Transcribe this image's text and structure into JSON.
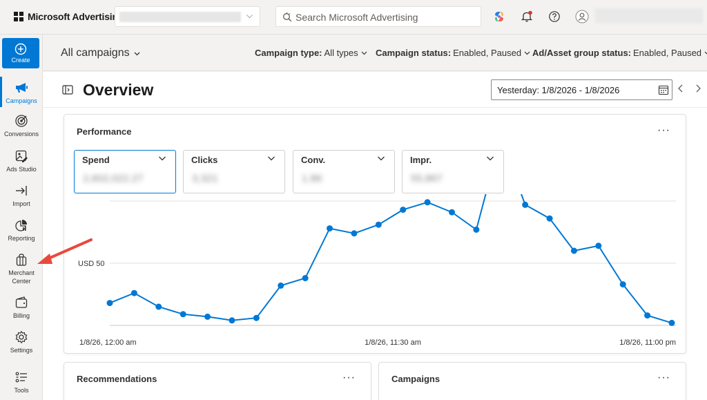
{
  "app": {
    "brand": "Microsoft Advertising",
    "search_placeholder": "Search Microsoft Advertising"
  },
  "nav": {
    "create_label": "Create",
    "items": [
      {
        "label": "Campaigns",
        "icon": "megaphone-icon"
      },
      {
        "label": "Conversions",
        "icon": "target-icon"
      },
      {
        "label": "Ads Studio",
        "icon": "image-edit-icon"
      },
      {
        "label": "Import",
        "icon": "import-arrow-icon"
      },
      {
        "label": "Reporting",
        "icon": "pie-chart-icon"
      },
      {
        "label": "Merchant Center",
        "icon": "shopping-bag-icon"
      },
      {
        "label": "Billing",
        "icon": "wallet-icon"
      },
      {
        "label": "Settings",
        "icon": "gear-icon"
      },
      {
        "label": "Tools",
        "icon": "tools-list-icon"
      }
    ]
  },
  "filters": {
    "scope_label": "All campaigns",
    "campaign_type_name": "Campaign type:",
    "campaign_type_value": "All types",
    "campaign_status_name": "Campaign status:",
    "campaign_status_value": "Enabled, Paused",
    "group_status_name": "Ad/Asset group status:",
    "group_status_value": "Enabled, Paused"
  },
  "page": {
    "title": "Overview",
    "date_range": "Yesterday: 1/8/2026 - 1/8/2026"
  },
  "performance": {
    "title": "Performance",
    "more": "···",
    "metrics": [
      {
        "label": "Spend",
        "value": "2,602,022.27"
      },
      {
        "label": "Clicks",
        "value": "3,321"
      },
      {
        "label": "Conv.",
        "value": "1.86"
      },
      {
        "label": "Impr.",
        "value": "55,867"
      }
    ]
  },
  "chart_data": {
    "type": "line",
    "x_start": "1/8/26, 12:00 am",
    "x_mid": "1/8/26, 11:30 am",
    "x_end": "1/8/26, 11:00 pm",
    "y_gridline_label": "USD 50",
    "y_gridline_value": 50,
    "ylim": [
      0,
      100
    ],
    "grid": true,
    "color": "#0078d4",
    "values": [
      18,
      26,
      15,
      9,
      7,
      4,
      6,
      32,
      38,
      78,
      74,
      81,
      93,
      99,
      91,
      77,
      151,
      97,
      86,
      60,
      64,
      33,
      8,
      2
    ]
  },
  "recommendations": {
    "title": "Recommendations",
    "more": "···"
  },
  "campaigns": {
    "title": "Campaigns",
    "more": "···"
  },
  "colors": {
    "accent": "#0078d4",
    "annotation_arrow": "#e8493c"
  }
}
